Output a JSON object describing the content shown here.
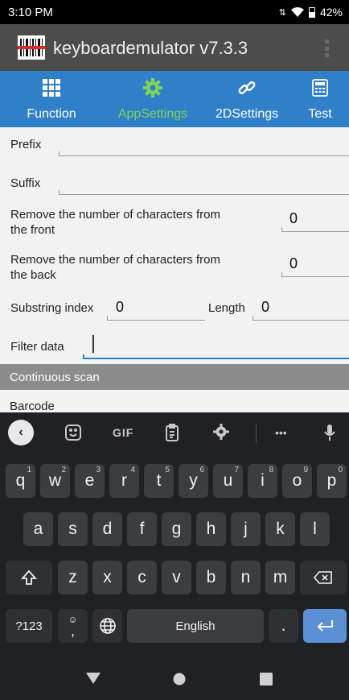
{
  "status_bar": {
    "time": "3:10 PM",
    "battery": "42%"
  },
  "app_bar": {
    "title": "keyboardemulator v7.3.3"
  },
  "tabs": [
    {
      "label": "Function",
      "icon": "grid-icon",
      "active": false
    },
    {
      "label": "AppSettings",
      "icon": "gear-icon",
      "active": true
    },
    {
      "label": "2DSettings",
      "icon": "link-icon",
      "active": false
    },
    {
      "label": "Test",
      "icon": "calculator-icon",
      "active": false
    }
  ],
  "form": {
    "prefix_label": "Prefix",
    "prefix_value": "",
    "suffix_label": "Suffix",
    "suffix_value": "",
    "remove_front_label_1": "Remove the number of characters from",
    "remove_front_label_2": "the front",
    "remove_front_value": "0",
    "remove_back_label_1": "Remove the number of characters from",
    "remove_back_label_2": "the back",
    "remove_back_value": "0",
    "substring_label": "Substring index",
    "substring_value": "0",
    "length_label": "Length",
    "length_value": "0",
    "filter_label": "Filter data",
    "filter_value": "",
    "section_title": "Continuous scan",
    "barcode_label": "Barcode"
  },
  "keyboard": {
    "toolbar": {
      "gif_label": "GIF",
      "more_label": "•••"
    },
    "row1": [
      {
        "key": "q",
        "hint": "1"
      },
      {
        "key": "w",
        "hint": "2"
      },
      {
        "key": "e",
        "hint": "3"
      },
      {
        "key": "r",
        "hint": "4"
      },
      {
        "key": "t",
        "hint": "5"
      },
      {
        "key": "y",
        "hint": "6"
      },
      {
        "key": "u",
        "hint": "7"
      },
      {
        "key": "i",
        "hint": "8"
      },
      {
        "key": "o",
        "hint": "9"
      },
      {
        "key": "p",
        "hint": "0"
      }
    ],
    "row2": [
      "a",
      "s",
      "d",
      "f",
      "g",
      "h",
      "j",
      "k",
      "l"
    ],
    "row3": [
      "z",
      "x",
      "c",
      "v",
      "b",
      "n",
      "m"
    ],
    "symbols_label": "?123",
    "comma_label": ",",
    "space_label": "English",
    "period_label": "."
  },
  "colors": {
    "tab_bar": "#2f80c9",
    "tab_active": "#7fd35a",
    "app_bar": "#4c4c4c",
    "section_bar": "#8c8c8c",
    "keyboard_bg": "#202124",
    "key_bg": "#3c3d40",
    "enter_key": "#5b8fd6"
  }
}
